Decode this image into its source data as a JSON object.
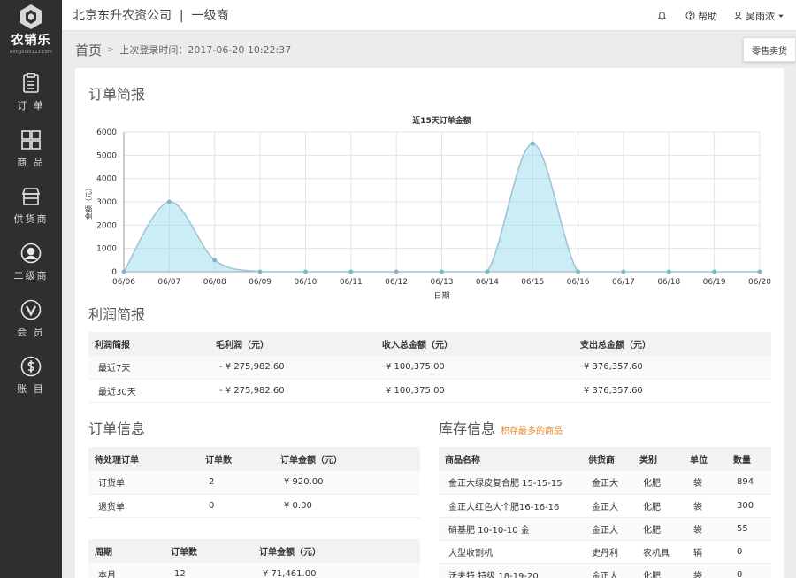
{
  "brand": {
    "name": "农销乐",
    "sub": "nongxiao123.com"
  },
  "nav": [
    {
      "label": "订 单",
      "icon": "order-icon"
    },
    {
      "label": "商 品",
      "icon": "grid-icon"
    },
    {
      "label": "供货商",
      "icon": "store-icon"
    },
    {
      "label": "二级商",
      "icon": "user-icon"
    },
    {
      "label": "会 员",
      "icon": "vip-icon"
    },
    {
      "label": "账 目",
      "icon": "dollar-icon"
    }
  ],
  "header": {
    "company": "北京东升农资公司  |  一级商",
    "bell_icon": "bell-icon",
    "help": "帮助",
    "user": "吴雨浓"
  },
  "breadcrumb": {
    "home": "首页",
    "sep": ">",
    "last_login": "上次登录时间：2017-06-20 10:22:37"
  },
  "retail_button": "零售卖货",
  "order_brief": {
    "title": "订单简报",
    "chart_data": {
      "type": "area",
      "title": "近15天订单金额",
      "xlabel": "日期",
      "ylabel": "金额（元）",
      "x": [
        "06/06",
        "06/07",
        "06/08",
        "06/09",
        "06/10",
        "06/11",
        "06/12",
        "06/13",
        "06/14",
        "06/15",
        "06/16",
        "06/17",
        "06/18",
        "06/19",
        "06/20"
      ],
      "values": [
        0,
        3000,
        500,
        0,
        0,
        0,
        0,
        0,
        0,
        5500,
        0,
        0,
        0,
        0,
        0
      ],
      "yticks": [
        "0",
        "1000",
        "2000",
        "3000",
        "4000",
        "5000",
        "6000"
      ],
      "ylim": [
        0,
        6000
      ],
      "grid": true,
      "color": "#8fd6e8"
    }
  },
  "profit": {
    "title": "利润简报",
    "headers": [
      "利润简报",
      "毛利润（元）",
      "收入总金额（元）",
      "支出总金额（元）"
    ],
    "rows": [
      [
        "最近7天",
        "- ¥ 275,982.60",
        "¥ 100,375.00",
        "¥ 376,357.60"
      ],
      [
        "最近30天",
        "- ¥ 275,982.60",
        "¥ 100,375.00",
        "¥ 376,357.60"
      ]
    ]
  },
  "order_info": {
    "title": "订单信息",
    "headers": [
      "待处理订单",
      "订单数",
      "订单金额（元）"
    ],
    "rows": [
      [
        "订货单",
        "2",
        "¥ 920.00"
      ],
      [
        "退货单",
        "0",
        "¥ 0.00"
      ]
    ],
    "period_headers": [
      "周期",
      "订单数",
      "订单金额（元）"
    ],
    "period_rows": [
      [
        "本月",
        "12",
        "¥ 71,461.00"
      ]
    ]
  },
  "stock": {
    "title": "库存信息",
    "subtitle": "积存最多的商品",
    "headers": [
      "商品名称",
      "供货商",
      "类别",
      "单位",
      "数量"
    ],
    "rows": [
      [
        "金正大绿皮复合肥 15-15-15",
        "金正大",
        "化肥",
        "袋",
        "894"
      ],
      [
        "金正大红色大个肥16-16-16",
        "金正大",
        "化肥",
        "袋",
        "300"
      ],
      [
        "硝基肥 10-10-10 金",
        "金正大",
        "化肥",
        "袋",
        "55"
      ],
      [
        "大型收割机",
        "史丹利",
        "农机具",
        "辆",
        "0"
      ],
      [
        "沃夫特 特级 18-19-20",
        "金正大",
        "化肥",
        "袋",
        "0"
      ]
    ]
  }
}
